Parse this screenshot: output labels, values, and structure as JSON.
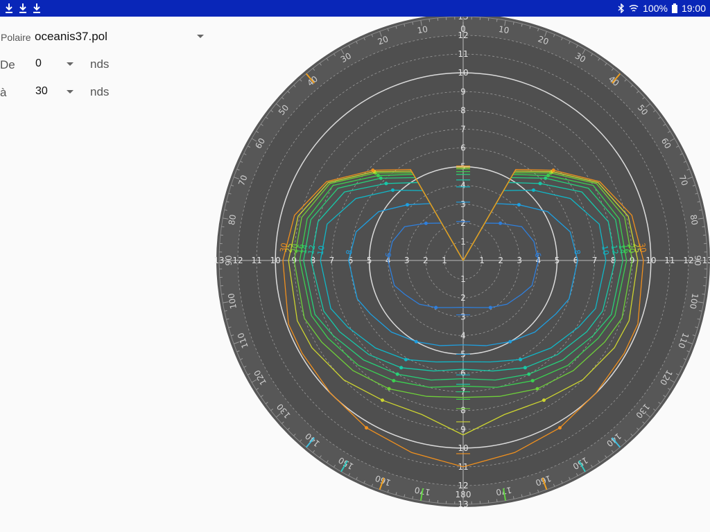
{
  "status": {
    "battery": "100%",
    "time": "19:00"
  },
  "form": {
    "polar_label": "Polaire",
    "polar_file": "oceanis37.pol",
    "from_label": "De",
    "from_value": "0",
    "to_label": "à",
    "to_value": "30",
    "unit": "nds"
  },
  "chart_data": {
    "type": "polar",
    "radial_max": 13,
    "radial_ticks": [
      "1",
      "2",
      "3",
      "4",
      "5",
      "6",
      "7",
      "8",
      "9",
      "10",
      "11",
      "12",
      "13"
    ],
    "angle_labels": [
      "10",
      "20",
      "30",
      "40",
      "50",
      "60",
      "70",
      "80",
      "90",
      "100",
      "110",
      "120",
      "130",
      "140",
      "150",
      "160",
      "170",
      "180"
    ],
    "top_label": "0",
    "bottom_label": "180",
    "angles": [
      0,
      30,
      45,
      60,
      75,
      90,
      110,
      120,
      135,
      150,
      165,
      180
    ],
    "series": [
      {
        "name": "6",
        "color": "#2f7fdc",
        "values": [
          0,
          2.3,
          2.8,
          3.6,
          3.9,
          4.0,
          3.9,
          3.6,
          3.3,
          2.9,
          2.6,
          2.5
        ]
      },
      {
        "name": "8",
        "color": "#1f9fe0",
        "values": [
          0,
          3.5,
          4.2,
          5.2,
          5.9,
          6.1,
          6.0,
          5.7,
          5.4,
          5.0,
          4.7,
          4.5
        ]
      },
      {
        "name": "10",
        "color": "#10b8c8",
        "values": [
          0,
          4.3,
          5.3,
          6.6,
          7.5,
          7.6,
          7.5,
          7.1,
          6.6,
          6.1,
          5.6,
          5.4
        ]
      },
      {
        "name": "12",
        "color": "#18c8a8",
        "values": [
          0,
          4.8,
          5.8,
          7.3,
          8.0,
          8.1,
          7.9,
          7.6,
          7.1,
          6.6,
          6.1,
          5.8
        ]
      },
      {
        "name": "14",
        "color": "#28d078",
        "values": [
          0,
          5.1,
          6.2,
          7.7,
          8.4,
          8.5,
          8.4,
          8.0,
          7.5,
          7.0,
          6.6,
          6.3
        ]
      },
      {
        "name": "16",
        "color": "#3cd050",
        "values": [
          0,
          5.3,
          6.4,
          8.0,
          8.6,
          8.7,
          8.6,
          8.3,
          7.9,
          7.4,
          7.0,
          6.7
        ]
      },
      {
        "name": "20",
        "color": "#6ed03a",
        "values": [
          0,
          5.4,
          6.6,
          8.2,
          8.9,
          9.0,
          9.0,
          8.7,
          8.3,
          7.9,
          7.5,
          7.3
        ]
      },
      {
        "name": "25",
        "color": "#cdd430",
        "values": [
          0,
          5.5,
          6.7,
          8.3,
          9.1,
          9.3,
          9.4,
          9.3,
          9.0,
          8.6,
          8.5,
          9.3
        ]
      },
      {
        "name": "30",
        "color": "#f0901e",
        "values": [
          0,
          5.6,
          6.8,
          8.4,
          9.3,
          9.6,
          9.9,
          9.9,
          10.0,
          10.3,
          10.6,
          11.0
        ]
      }
    ]
  }
}
